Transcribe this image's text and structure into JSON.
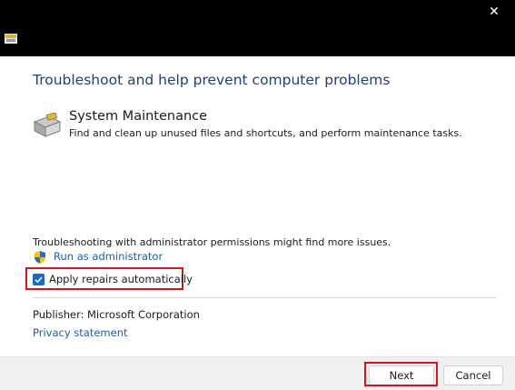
{
  "window": {
    "close_symbol": "✕",
    "icon": "troubleshooter-app-icon"
  },
  "main": {
    "heading": "Troubleshoot and help prevent computer problems",
    "item": {
      "icon": "system-maintenance-icon",
      "title": "System Maintenance",
      "description": "Find and clean up unused files and shortcuts, and perform maintenance tasks."
    },
    "admin_note": "Troubleshooting with administrator permissions might find more issues.",
    "run_as_admin": "Run as administrator",
    "apply_repairs": {
      "label": "Apply repairs automatically",
      "checked": true
    },
    "publisher_label": "Publisher:",
    "publisher_value": "Microsoft Corporation",
    "privacy_link": "Privacy statement"
  },
  "footer": {
    "next_label": "Next",
    "cancel_label": "Cancel"
  },
  "colors": {
    "heading": "#1f3e7a",
    "link": "#1f5fa6",
    "highlight": "#d1171d",
    "checkbox": "#1769c4"
  }
}
